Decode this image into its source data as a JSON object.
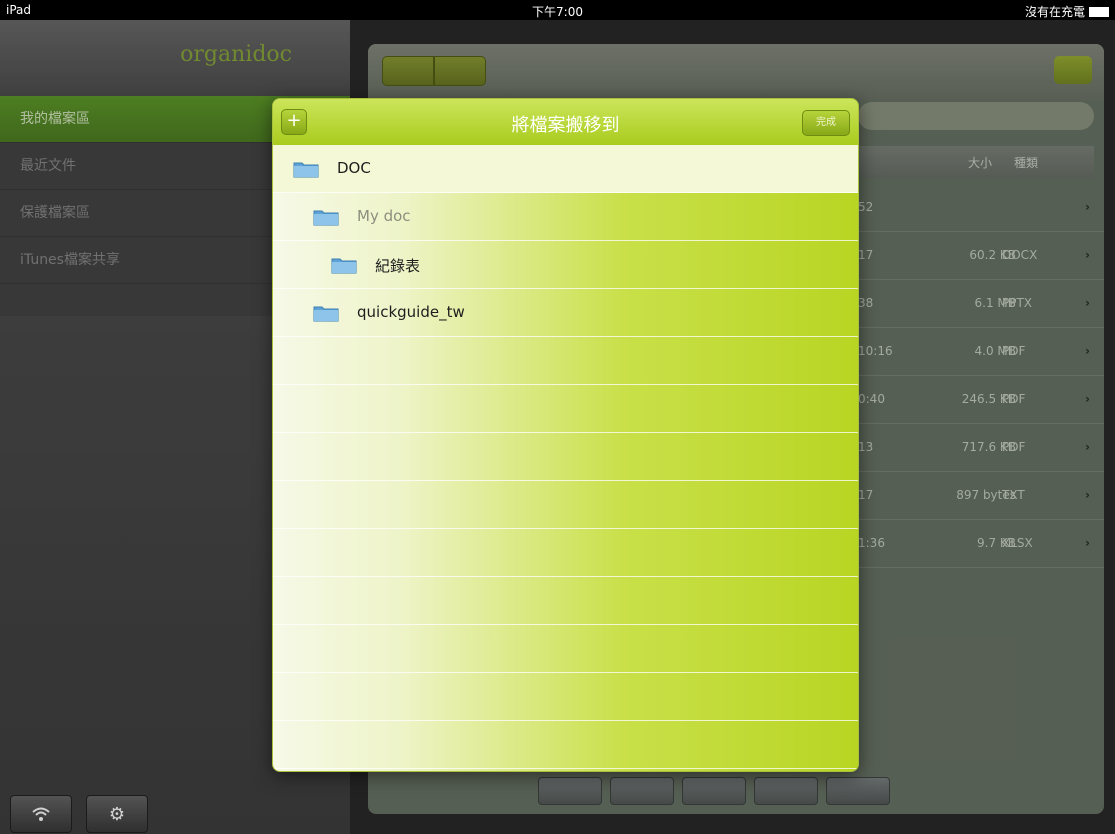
{
  "status_bar": {
    "device": "iPad",
    "time": "下午7:00",
    "charging": "沒有在充電"
  },
  "sidebar": {
    "brand": "organidoc",
    "items": [
      {
        "label": "我的檔案區",
        "active": true
      },
      {
        "label": "最近文件",
        "active": false
      },
      {
        "label": "保護檔案區",
        "active": false
      },
      {
        "label": "iTunes檔案共享",
        "active": false
      }
    ],
    "tools": [
      "wifi-icon",
      "gear-icon"
    ]
  },
  "main": {
    "table_headers": [
      "大小",
      "種類"
    ],
    "rows": [
      {
        "time": "52",
        "size": "",
        "type": ""
      },
      {
        "time": "17",
        "size": "60.2 KB",
        "type": "DOCX"
      },
      {
        "time": "38",
        "size": "6.1 MB",
        "type": "PPTX"
      },
      {
        "time": "10:16",
        "size": "4.0 MB",
        "type": "PDF"
      },
      {
        "time": "0:40",
        "size": "246.5 KB",
        "type": "PDF"
      },
      {
        "time": "13",
        "size": "717.6 KB",
        "type": "PDF"
      },
      {
        "time": "17",
        "size": "897 bytes",
        "type": "TXT"
      },
      {
        "time": "1:36",
        "size": "9.7 KB",
        "type": "XLSX"
      }
    ]
  },
  "popover": {
    "title": "將檔案搬移到",
    "add_label": "+",
    "done_label": "完成",
    "folders": [
      {
        "label": "DOC",
        "indent": 0,
        "selected": true,
        "disabled": false
      },
      {
        "label": "My doc",
        "indent": 1,
        "selected": false,
        "disabled": true
      },
      {
        "label": "紀錄表",
        "indent": 2,
        "selected": false,
        "disabled": false
      },
      {
        "label": "quickguide_tw",
        "indent": 1,
        "selected": false,
        "disabled": false
      }
    ]
  },
  "colors": {
    "accent_green": "#a9cc1e",
    "sidebar_active": "#5e9a2a"
  }
}
